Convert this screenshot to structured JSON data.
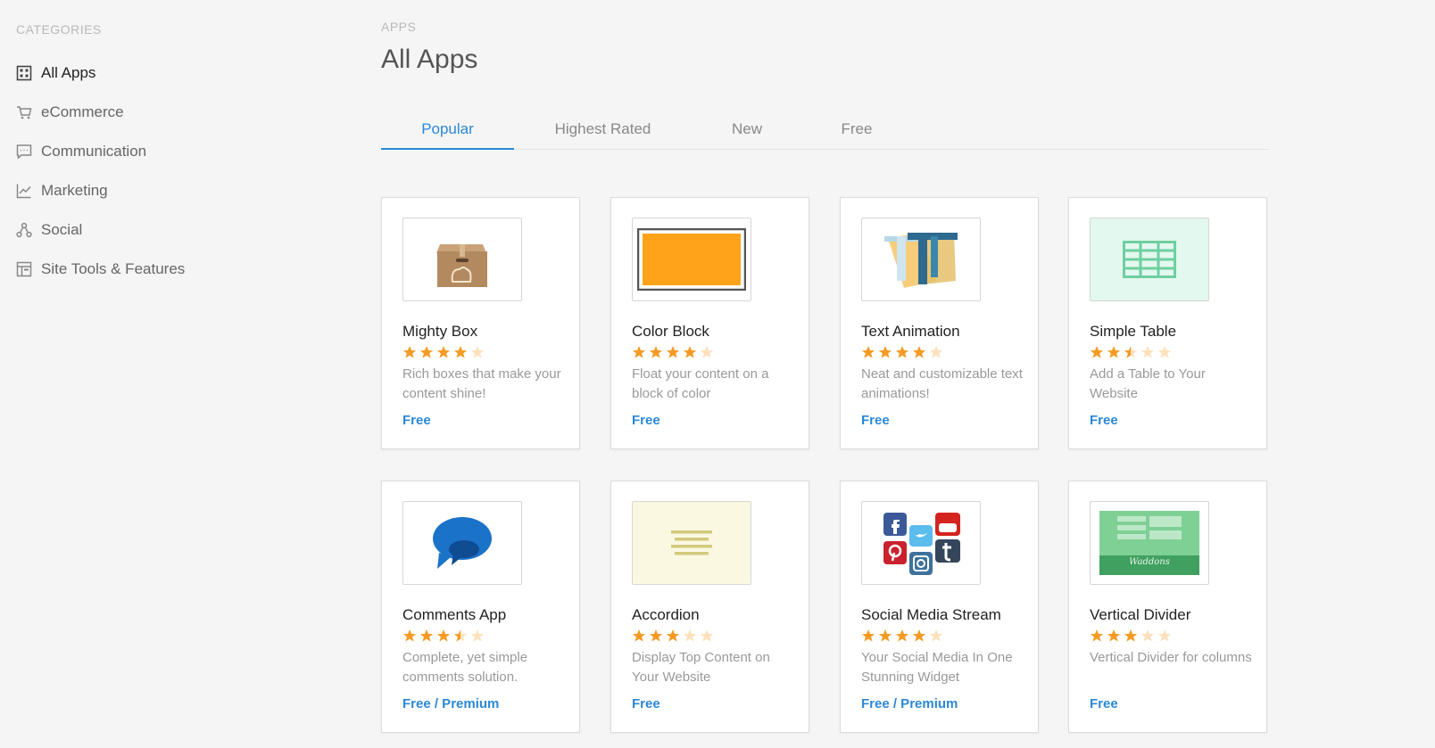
{
  "sidebar": {
    "heading": "CATEGORIES",
    "items": [
      {
        "label": "All Apps",
        "icon": "grid-icon"
      },
      {
        "label": "eCommerce",
        "icon": "cart-icon"
      },
      {
        "label": "Communication",
        "icon": "chat-icon"
      },
      {
        "label": "Marketing",
        "icon": "chart-icon"
      },
      {
        "label": "Social",
        "icon": "share-icon"
      },
      {
        "label": "Site Tools & Features",
        "icon": "layout-icon"
      }
    ]
  },
  "header": {
    "breadcrumb": "APPS",
    "title": "All Apps"
  },
  "tabs": [
    "Popular",
    "Highest Rated",
    "New",
    "Free"
  ],
  "colors": {
    "accent": "#2b88d8",
    "star": "#f59a23",
    "star_empty": "#fde1bd"
  },
  "apps": [
    {
      "title": "Mighty Box",
      "rating": 4,
      "desc": "Rich boxes that make your content shine!",
      "price": "Free",
      "thumb": "box-icon"
    },
    {
      "title": "Color Block",
      "rating": 4,
      "desc": "Float your content on a block of color",
      "price": "Free",
      "thumb": "color-block-icon"
    },
    {
      "title": "Text Animation",
      "rating": 4,
      "desc": "Neat and customizable text animations!",
      "price": "Free",
      "thumb": "text-animation-icon"
    },
    {
      "title": "Simple Table",
      "rating": 2.5,
      "desc": "Add a Table to Your Website",
      "price": "Free",
      "thumb": "table-icon"
    },
    {
      "title": "Comments App",
      "rating": 3.5,
      "desc": "Complete, yet simple comments solution.",
      "price": "Free / Premium",
      "thumb": "comments-icon"
    },
    {
      "title": "Accordion",
      "rating": 3,
      "desc": "Display Top Content on Your Website",
      "price": "Free",
      "thumb": "accordion-icon"
    },
    {
      "title": "Social Media Stream",
      "rating": 4,
      "desc": "Your Social Media In One Stunning Widget",
      "price": "Free / Premium",
      "thumb": "social-media-icon"
    },
    {
      "title": "Vertical Divider",
      "rating": 3,
      "desc": "Vertical Divider for columns",
      "price": "Free",
      "thumb": "divider-icon",
      "thumb_text": "Waddons"
    }
  ]
}
